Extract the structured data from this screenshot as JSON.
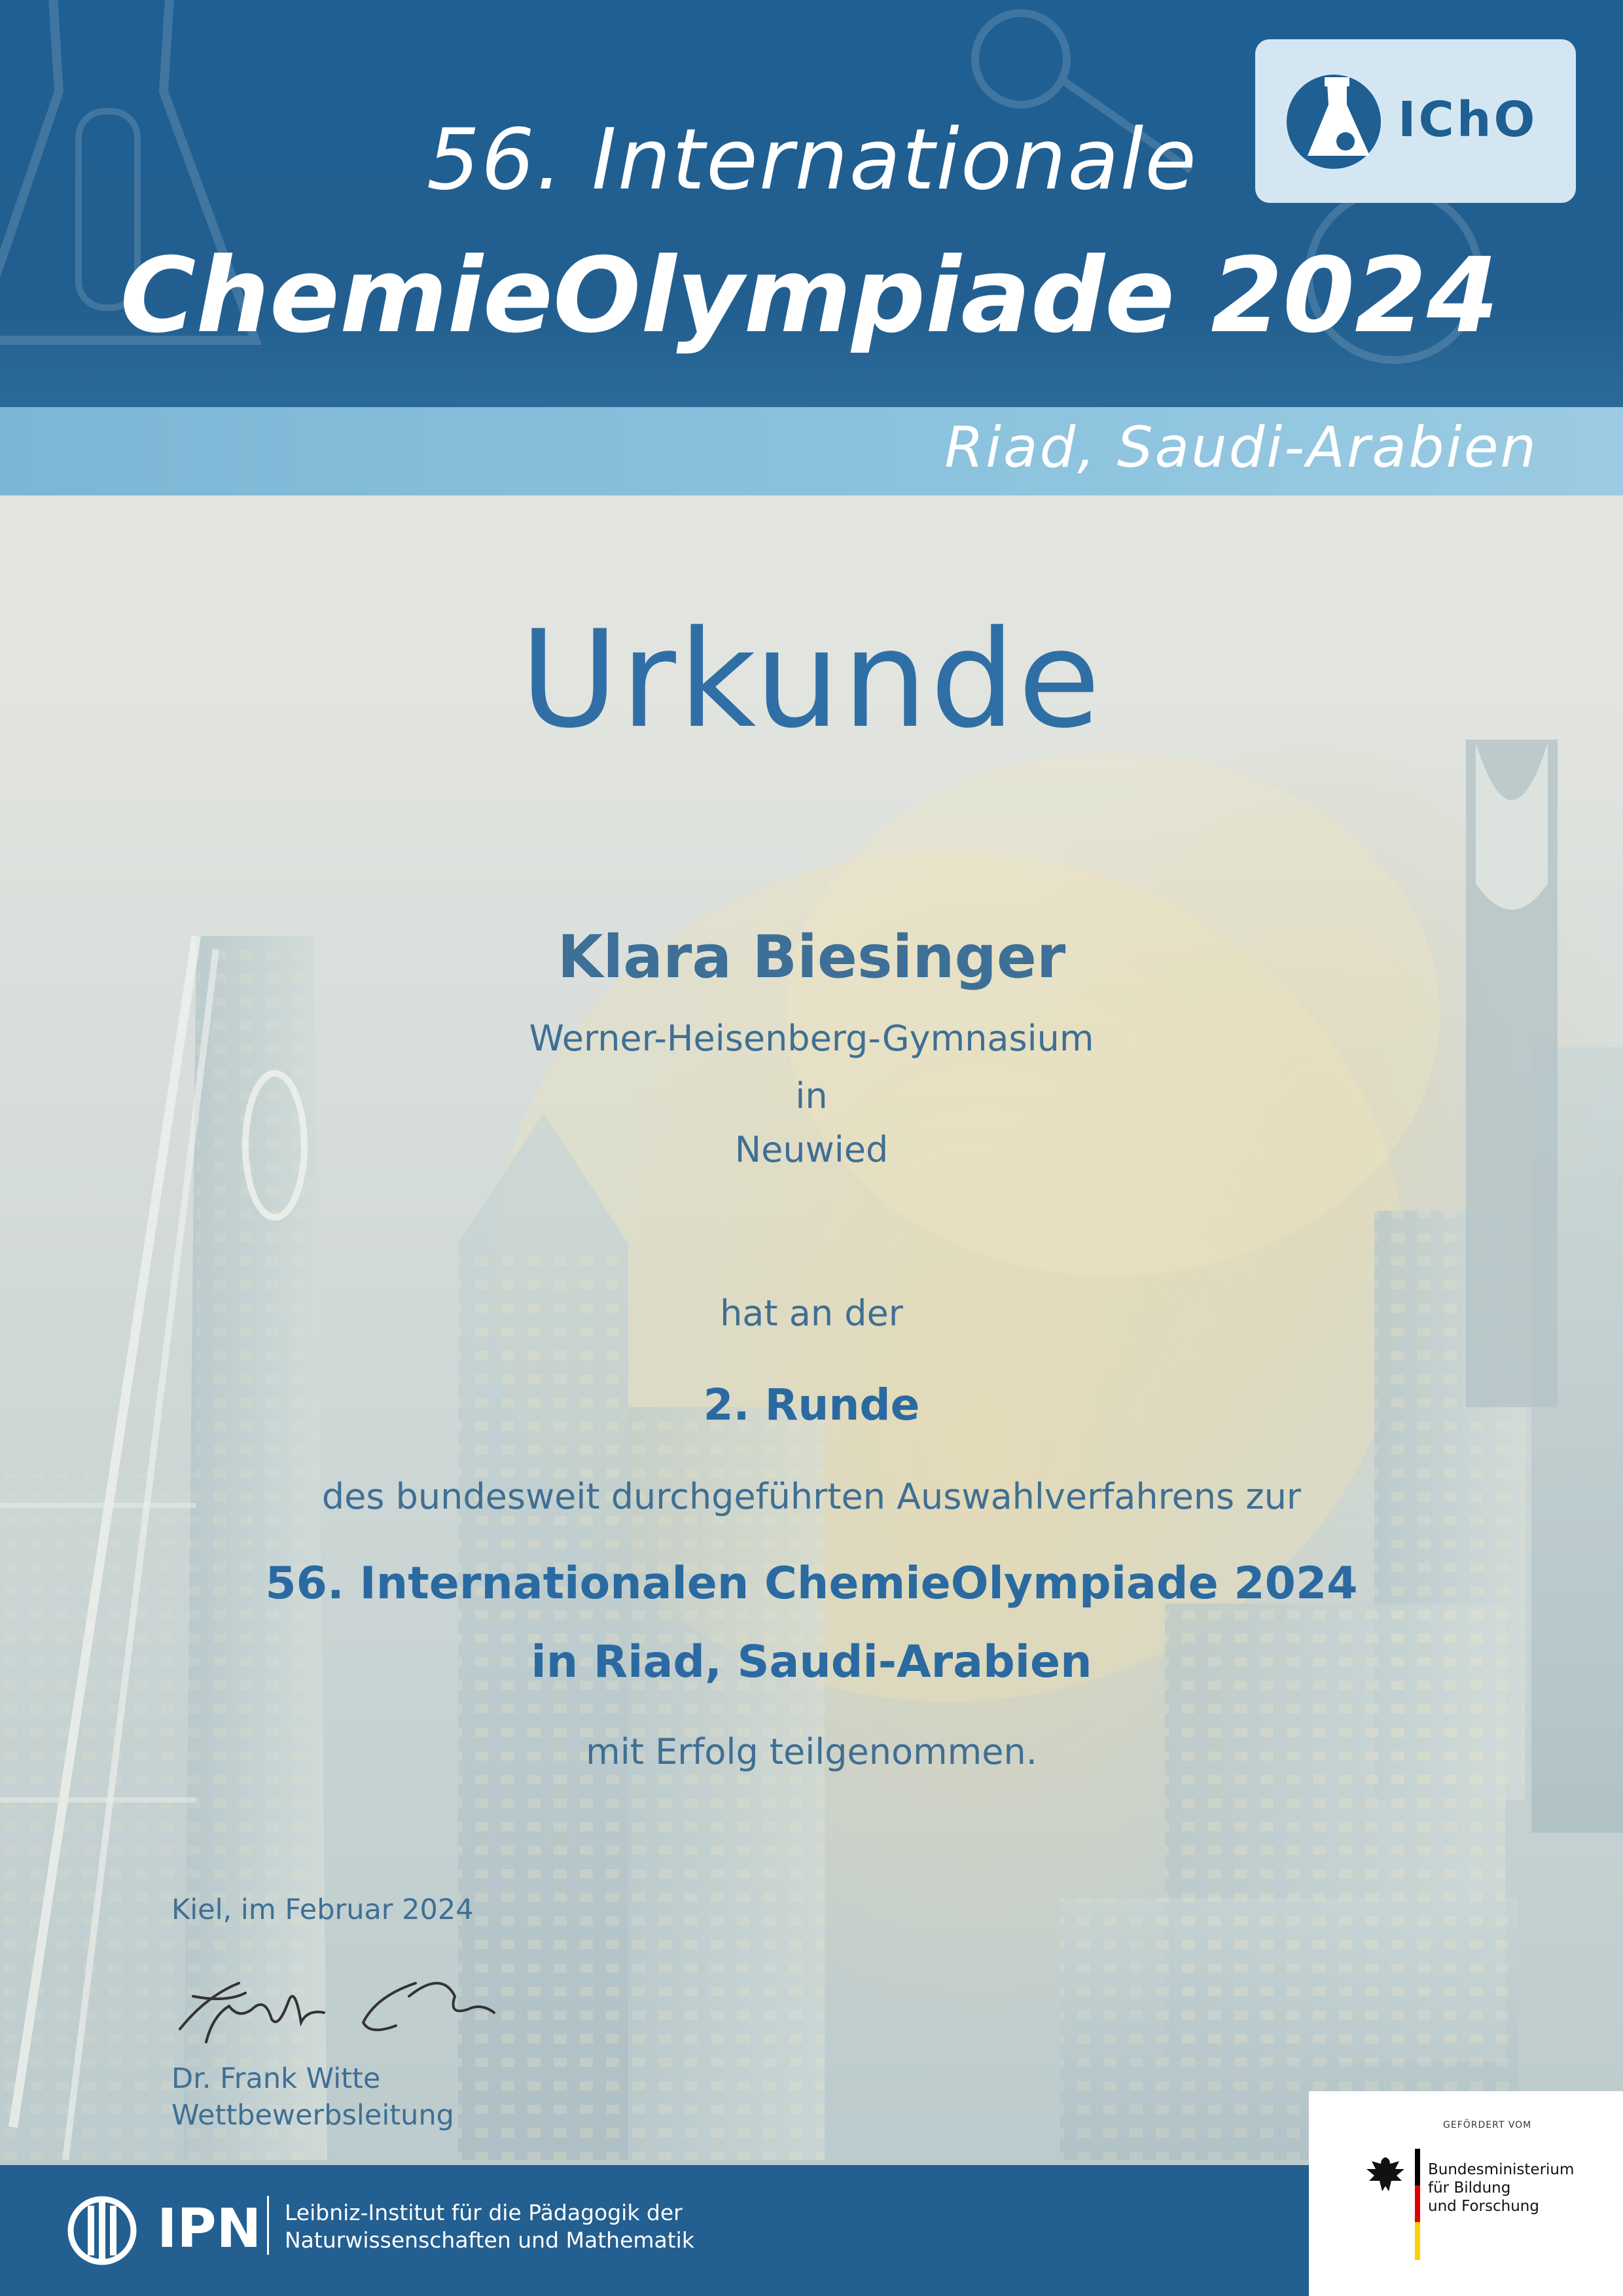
{
  "header": {
    "line1": "56. Internationale",
    "line2": "ChemieOlympiade 2024",
    "location": "Riad, Saudi-Arabien",
    "logo_text": "IChO"
  },
  "certificate": {
    "title": "Urkunde",
    "recipient": "Klara Biesinger",
    "school": "Werner-Heisenberg-Gymnasium",
    "in_label": "in",
    "city": "Neuwied",
    "participation_intro": "hat an der",
    "round": "2. Runde",
    "procedure": "des bundesweit durchgeführten Auswahlverfahrens zur",
    "event_line1": "56. Internationalen ChemieOlympiade 2024",
    "event_line2": "in Riad, Saudi-Arabien",
    "closing": "mit Erfolg teilgenommen."
  },
  "signature": {
    "place_date": "Kiel, im Februar 2024",
    "signer_name": "Dr. Frank Witte",
    "signer_role": "Wettbewerbsleitung"
  },
  "footer": {
    "ipn_label": "IPN",
    "ipn_desc_line1": "Leibniz-Institut für die Pädagogik der",
    "ipn_desc_line2": "Naturwissenschaften und Mathematik",
    "sponsor_label": "GEFÖRDERT VOM",
    "sponsor_line1": "Bundesministerium",
    "sponsor_line2": "für Bildung",
    "sponsor_line3": "und Forschung"
  },
  "colors": {
    "header_blue": "#225f90",
    "subbar_blue": "#8cc3de",
    "text_blue": "#3f6f94",
    "accent_blue": "#2a6aa0"
  }
}
